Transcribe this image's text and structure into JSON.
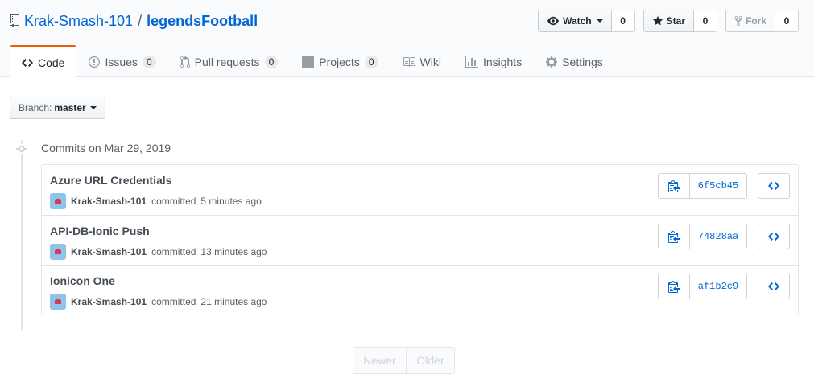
{
  "repo": {
    "owner": "Krak-Smash-101",
    "separator": "/",
    "name": "legendsFootball"
  },
  "actions": {
    "watch": {
      "label": "Watch",
      "count": "0"
    },
    "star": {
      "label": "Star",
      "count": "0"
    },
    "fork": {
      "label": "Fork",
      "count": "0"
    }
  },
  "tabs": [
    {
      "label": "Code",
      "icon": "code-icon",
      "selected": true
    },
    {
      "label": "Issues",
      "icon": "issue-icon",
      "counter": "0"
    },
    {
      "label": "Pull requests",
      "icon": "pull-request-icon",
      "counter": "0"
    },
    {
      "label": "Projects",
      "icon": "project-icon",
      "counter": "0"
    },
    {
      "label": "Wiki",
      "icon": "book-icon"
    },
    {
      "label": "Insights",
      "icon": "graph-icon"
    },
    {
      "label": "Settings",
      "icon": "gear-icon"
    }
  ],
  "branch": {
    "label": "Branch:",
    "value": "master"
  },
  "commit_group": {
    "title": "Commits on Mar 29, 2019"
  },
  "commits": [
    {
      "message": "Azure URL Credentials",
      "author": "Krak-Smash-101",
      "action": "committed",
      "time": "5 minutes ago",
      "sha": "6f5cb45"
    },
    {
      "message": "API-DB-Ionic Push",
      "author": "Krak-Smash-101",
      "action": "committed",
      "time": "13 minutes ago",
      "sha": "74828aa"
    },
    {
      "message": "Ionicon One",
      "author": "Krak-Smash-101",
      "action": "committed",
      "time": "21 minutes ago",
      "sha": "af1b2c9"
    }
  ],
  "pagination": {
    "newer": "Newer",
    "older": "Older"
  },
  "colors": {
    "link": "#0366d6",
    "selected_tab_accent": "#e36209",
    "avatar": "#8fc3e8"
  }
}
